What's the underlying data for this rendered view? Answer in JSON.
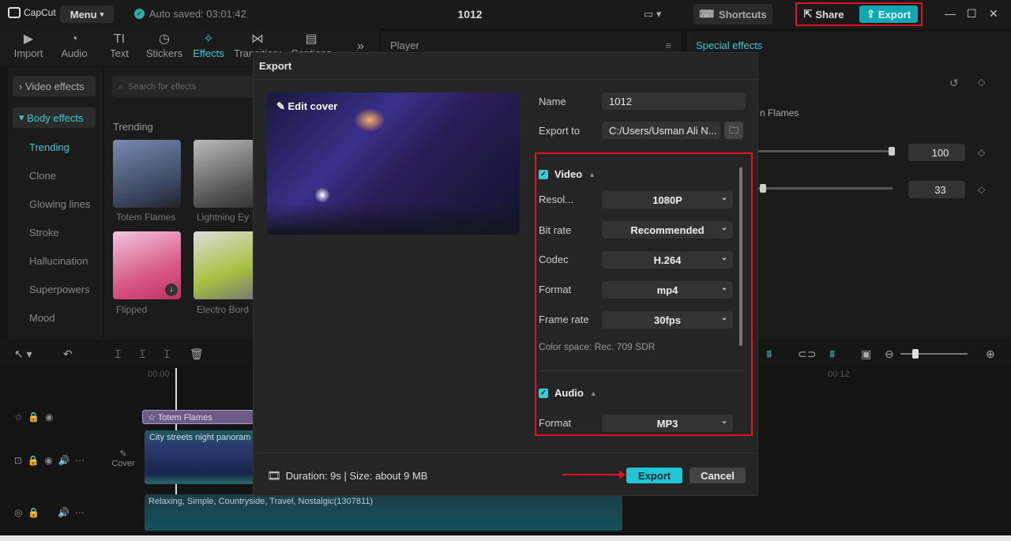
{
  "app": {
    "name": "CapCut",
    "menu_label": "Menu",
    "autosave_text": "Auto saved: 03:01:42",
    "project_title": "1012"
  },
  "topbar": {
    "shortcuts_label": "Shortcuts",
    "share_label": "Share",
    "export_label": "Export"
  },
  "toolbar": {
    "items": [
      {
        "label": "Import",
        "icon": "import-icon"
      },
      {
        "label": "Audio",
        "icon": "audio-icon"
      },
      {
        "label": "Text",
        "icon": "text-icon"
      },
      {
        "label": "Stickers",
        "icon": "stickers-icon"
      },
      {
        "label": "Effects",
        "icon": "effects-icon",
        "active": true
      },
      {
        "label": "Transitions",
        "icon": "transitions-icon"
      },
      {
        "label": "Captions",
        "icon": "captions-icon"
      }
    ]
  },
  "left_panel": {
    "categories": [
      {
        "label": "Video effects"
      },
      {
        "label": "Body effects",
        "selected": true
      }
    ],
    "subcategories": [
      "Trending",
      "Clone",
      "Glowing lines",
      "Stroke",
      "Hallucination",
      "Superpowers",
      "Mood"
    ],
    "search_placeholder": "Search for effects",
    "section_title": "Trending",
    "effects": [
      "Totem Flames",
      "Lightning Ey",
      "Flipped",
      "Electro Bord"
    ]
  },
  "player": {
    "title": "Player"
  },
  "right_panel": {
    "title": "Special effects",
    "effect_name": "n Flames",
    "values": [
      "100",
      "33"
    ]
  },
  "timeline": {
    "time_start": "00:00",
    "time_mark": "00:12",
    "effect_clip": "Totem Flames",
    "video_clip": "City streets night panoram",
    "cover_label": "Cover",
    "audio_clip": "Relaxing, Simple, Countryside, Travel, Nostalgic(1307811)"
  },
  "export_dialog": {
    "title": "Export",
    "edit_cover": "Edit cover",
    "name_label": "Name",
    "name_value": "1012",
    "export_to_label": "Export to",
    "export_to_value": "C:/Users/Usman Ali N...",
    "video_section": "Video",
    "video_settings": [
      {
        "label": "Resol...",
        "value": "1080P"
      },
      {
        "label": "Bit rate",
        "value": "Recommended"
      },
      {
        "label": "Codec",
        "value": "H.264"
      },
      {
        "label": "Format",
        "value": "mp4"
      },
      {
        "label": "Frame rate",
        "value": "30fps"
      }
    ],
    "color_space": "Color space: Rec. 709 SDR",
    "audio_section": "Audio",
    "audio_settings": [
      {
        "label": "Format",
        "value": "MP3"
      }
    ],
    "footer_info": "Duration: 9s | Size: about 9 MB",
    "export_button": "Export",
    "cancel_button": "Cancel"
  },
  "colors": {
    "accent": "#20c6d4",
    "highlight": "#e0141e"
  }
}
